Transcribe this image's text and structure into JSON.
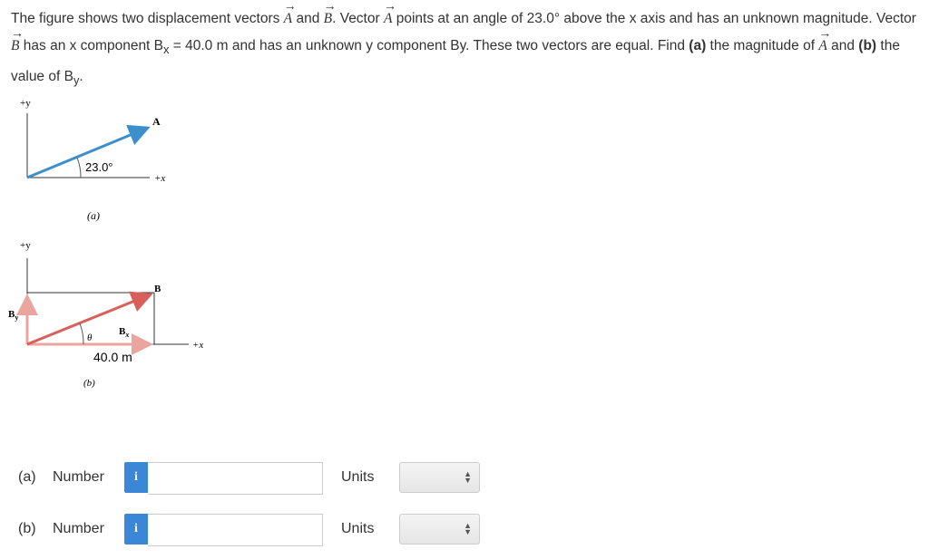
{
  "question": {
    "p1": "The figure shows two displacement vectors ",
    "vecA": "A",
    "and": " and ",
    "vecB": "B",
    "p2": ". Vector ",
    "p3": " points at an angle of 23.0° above the x axis and has an unknown magnitude. Vector ",
    "p4": " has an x component B",
    "sub_x": "x",
    "p5": " = 40.0 m and has an unknown y component By. These two vectors are equal. Find ",
    "a_bold": "(a)",
    "p6": " the magnitude of ",
    "p7": " and ",
    "b_bold": "(b)",
    "p8": " the value of B",
    "sub_y": "y",
    "p9": "."
  },
  "figure": {
    "a": {
      "y_axis": "+y",
      "x_axis": "+x",
      "vector": "A",
      "angle": "23.0°",
      "caption": "(a)",
      "color": "#3d8fcb"
    },
    "b": {
      "y_axis": "+y",
      "x_axis": "+x",
      "vector": "B",
      "by": "B",
      "by_sub": "y",
      "bx": "B",
      "bx_sub": "x",
      "theta": "θ",
      "bx_value": "40.0 m",
      "caption": "(b)",
      "color": "#d9605a",
      "component_color": "#eba59f"
    }
  },
  "answers": [
    {
      "part": "(a)",
      "label": "Number",
      "info": "i",
      "value": "",
      "units_label": "Units",
      "units_value": ""
    },
    {
      "part": "(b)",
      "label": "Number",
      "info": "i",
      "value": "",
      "units_label": "Units",
      "units_value": ""
    }
  ]
}
